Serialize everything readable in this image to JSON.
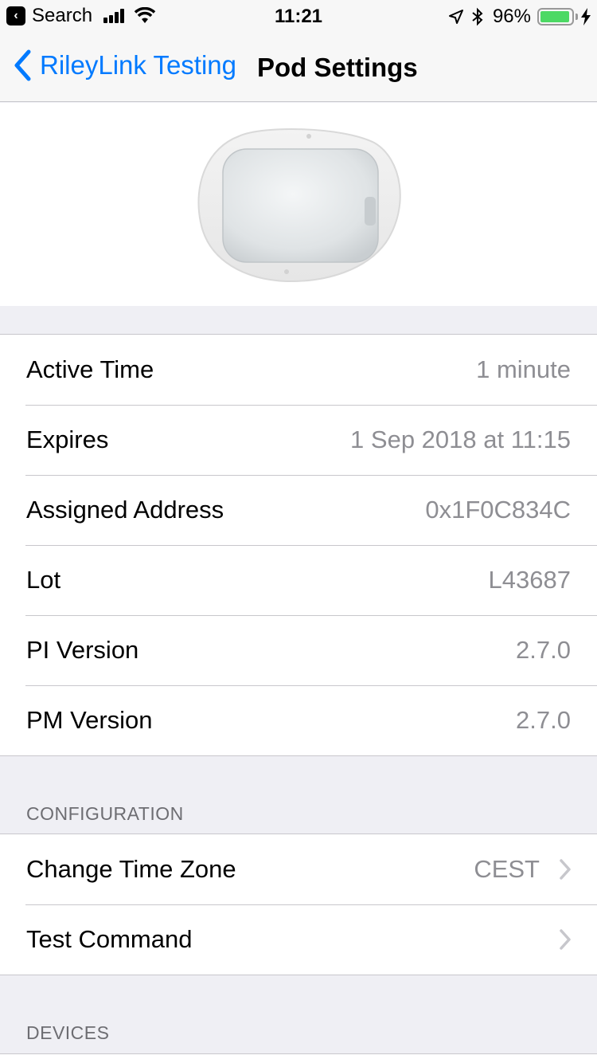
{
  "status_bar": {
    "back_app": "Search",
    "time": "11:21",
    "battery_percent": "96%",
    "battery_level": 0.96
  },
  "nav": {
    "back_label": "RileyLink Testing",
    "title": "Pod Settings"
  },
  "pod_info": {
    "rows": [
      {
        "label": "Active Time",
        "value": "1 minute"
      },
      {
        "label": "Expires",
        "value": "1 Sep 2018 at 11:15"
      },
      {
        "label": "Assigned Address",
        "value": "0x1F0C834C"
      },
      {
        "label": "Lot",
        "value": "L43687"
      },
      {
        "label": "PI Version",
        "value": "2.7.0"
      },
      {
        "label": "PM Version",
        "value": "2.7.0"
      }
    ]
  },
  "configuration": {
    "header": "CONFIGURATION",
    "rows": [
      {
        "label": "Change Time Zone",
        "value": "CEST"
      },
      {
        "label": "Test Command",
        "value": ""
      }
    ]
  },
  "devices": {
    "header": "DEVICES"
  },
  "colors": {
    "accent": "#007aff",
    "secondary_text": "#8e8e93",
    "background": "#efeff4",
    "battery": "#4cd964"
  }
}
